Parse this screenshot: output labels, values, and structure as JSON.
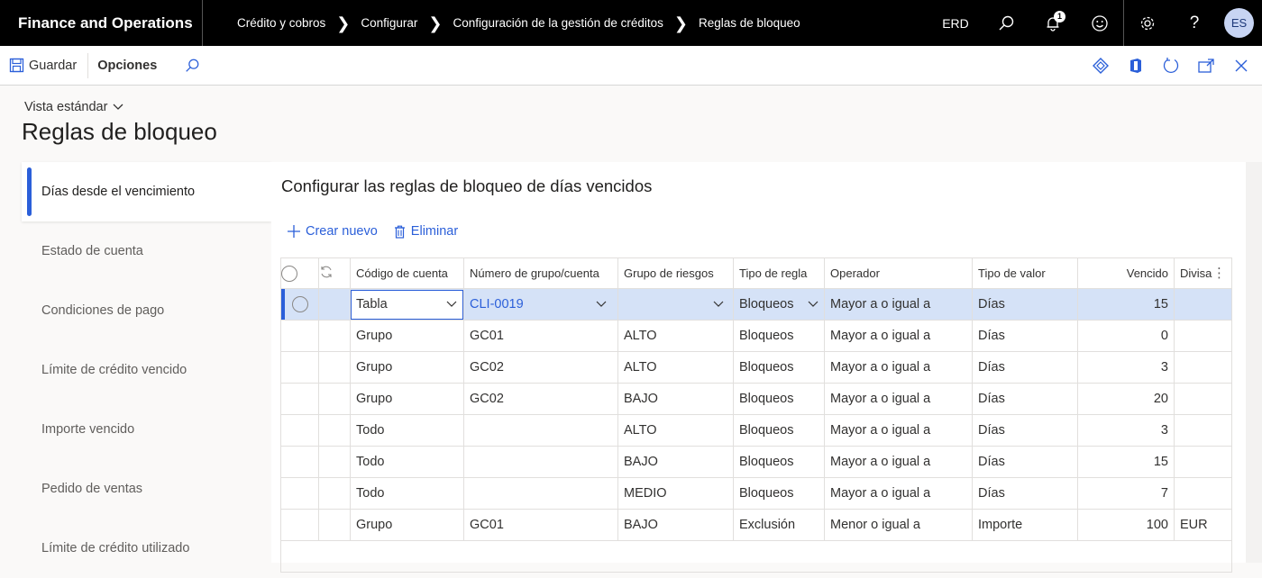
{
  "topbar": {
    "app_title": "Finance and Operations",
    "breadcrumb": [
      "Crédito y cobros",
      "Configurar",
      "Configuración de la gestión de créditos",
      "Reglas de bloqueo"
    ],
    "company": "ERD",
    "notification_count": "1",
    "avatar_initials": "ES",
    "icons": [
      "search-icon",
      "bell-icon",
      "smiley-icon",
      "gear-icon",
      "help-icon"
    ]
  },
  "actionbar": {
    "save_label": "Guardar",
    "options_label": "Opciones",
    "right_icons": [
      "power-apps-icon",
      "office-icon",
      "refresh-icon",
      "open-new-window-icon",
      "close-icon"
    ]
  },
  "page": {
    "view_selector": "Vista estándar",
    "title": "Reglas de bloqueo"
  },
  "sidenav": {
    "items": [
      {
        "label": "Días desde el vencimiento",
        "active": true
      },
      {
        "label": "Estado de cuenta",
        "active": false
      },
      {
        "label": "Condiciones de pago",
        "active": false
      },
      {
        "label": "Límite de crédito vencido",
        "active": false
      },
      {
        "label": "Importe vencido",
        "active": false
      },
      {
        "label": "Pedido de ventas",
        "active": false
      },
      {
        "label": "Límite de crédito utilizado",
        "active": false
      }
    ]
  },
  "content": {
    "section_title": "Configurar las reglas de bloqueo de días vencidos",
    "create_new_label": "Crear nuevo",
    "delete_label": "Eliminar",
    "columns": [
      "Código de cuenta",
      "Número de grupo/cuenta",
      "Grupo de riesgos",
      "Tipo de regla",
      "Operador",
      "Tipo de valor",
      "Vencido",
      "Divisa"
    ],
    "rows": [
      {
        "codigo": "Tabla",
        "numero": "CLI-0019",
        "riesgo": "",
        "tipo_regla": "Bloqueos",
        "operador": "Mayor a o igual a",
        "tipo_valor": "Días",
        "vencido": "15",
        "divisa": "",
        "selected": true
      },
      {
        "codigo": "Grupo",
        "numero": "GC01",
        "riesgo": "ALTO",
        "tipo_regla": "Bloqueos",
        "operador": "Mayor a o igual a",
        "tipo_valor": "Días",
        "vencido": "0",
        "divisa": ""
      },
      {
        "codigo": "Grupo",
        "numero": "GC02",
        "riesgo": "ALTO",
        "tipo_regla": "Bloqueos",
        "operador": "Mayor a o igual a",
        "tipo_valor": "Días",
        "vencido": "3",
        "divisa": ""
      },
      {
        "codigo": "Grupo",
        "numero": "GC02",
        "riesgo": "BAJO",
        "tipo_regla": "Bloqueos",
        "operador": "Mayor a o igual a",
        "tipo_valor": "Días",
        "vencido": "20",
        "divisa": ""
      },
      {
        "codigo": "Todo",
        "numero": "",
        "riesgo": "ALTO",
        "tipo_regla": "Bloqueos",
        "operador": "Mayor a o igual a",
        "tipo_valor": "Días",
        "vencido": "3",
        "divisa": ""
      },
      {
        "codigo": "Todo",
        "numero": "",
        "riesgo": "BAJO",
        "tipo_regla": "Bloqueos",
        "operador": "Mayor a o igual a",
        "tipo_valor": "Días",
        "vencido": "15",
        "divisa": ""
      },
      {
        "codigo": "Todo",
        "numero": "",
        "riesgo": "MEDIO",
        "tipo_regla": "Bloqueos",
        "operador": "Mayor a o igual a",
        "tipo_valor": "Días",
        "vencido": "7",
        "divisa": ""
      },
      {
        "codigo": "Grupo",
        "numero": "GC01",
        "riesgo": "BAJO",
        "tipo_regla": "Exclusión",
        "operador": "Menor o igual a",
        "tipo_valor": "Importe",
        "vencido": "100",
        "divisa": "EUR"
      }
    ]
  },
  "colors": {
    "accent": "#2b5fd9",
    "selected_row": "#d5e2f7",
    "topbar": "#000000"
  }
}
